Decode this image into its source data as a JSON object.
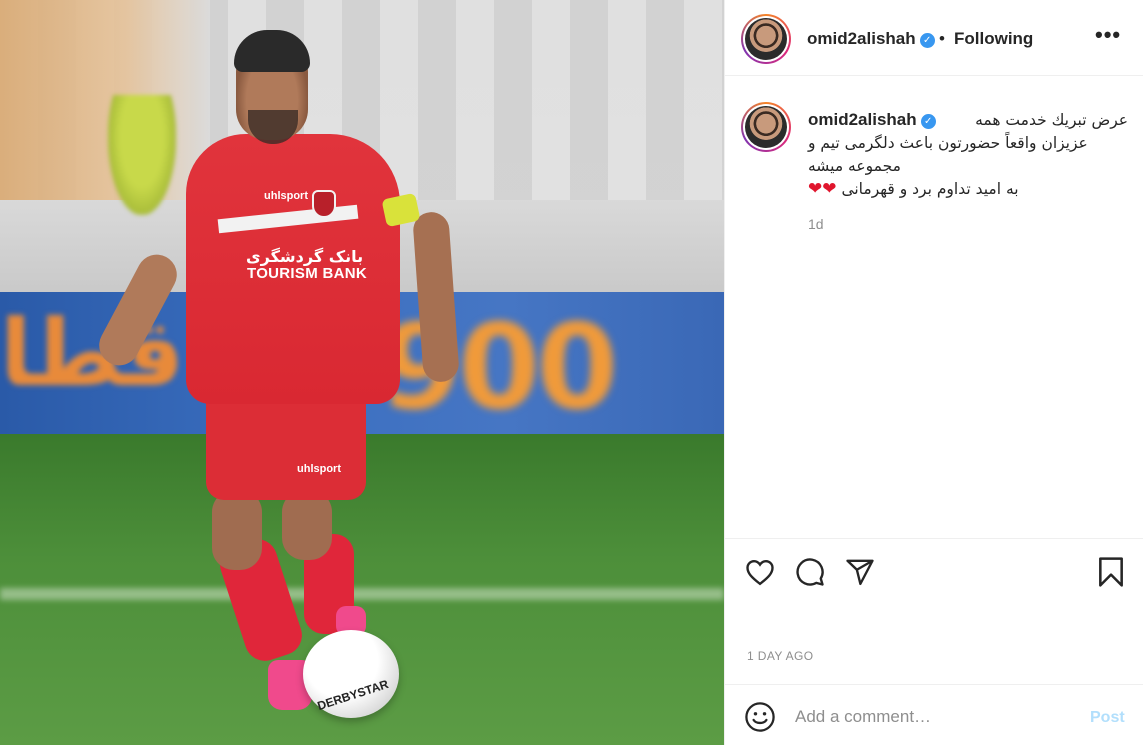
{
  "post": {
    "photo": {
      "alt_sponsor_persian": "بانک گردشگری",
      "sponsor_bank": "TOURISM BANK",
      "kit_brand": "uhlsport",
      "ball_brand": "DERBYSTAR",
      "board_number": "900"
    },
    "header": {
      "username": "omid2alishah",
      "verified_icon": "verified-badge-icon",
      "separator": "•",
      "follow_status": "Following",
      "more_label": "•••"
    },
    "caption": {
      "username": "omid2alishah",
      "lines": [
        "عرض تبريك خدمت همه",
        "عزيزان واقعاً حضورتون باعث دلگرمى تيم و",
        "مجموعه ميشه",
        "به اميد تداوم برد و قهرمانى"
      ],
      "hearts": "❤❤",
      "time_ago": "1d"
    },
    "actions": {
      "like_icon": "heart-icon",
      "comment_icon": "comment-bubble-icon",
      "share_icon": "paper-plane-icon",
      "save_icon": "bookmark-icon",
      "date_label": "1 DAY AGO"
    },
    "comment": {
      "emoji_icon": "smiley-icon",
      "placeholder": "Add a comment…",
      "post_label": "Post"
    },
    "colors": {
      "text": "#262626",
      "secondary": "#8e8e8e",
      "border": "#efefef",
      "verified": "#3897f0",
      "post_disabled": "#b2dffc",
      "heart": "#e0152d"
    }
  }
}
